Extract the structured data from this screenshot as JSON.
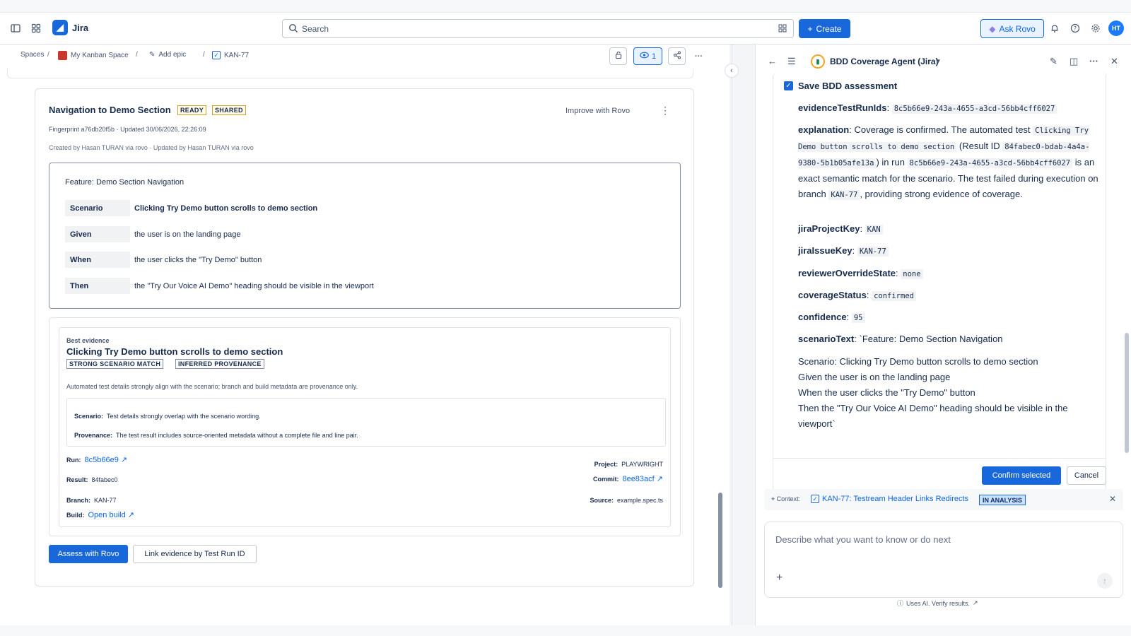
{
  "app": {
    "name": "Jira"
  },
  "search": {
    "placeholder": "Search"
  },
  "topbar": {
    "create_label": "Create",
    "ask_rovo_label": "Ask Rovo",
    "avatar_initials": "HT"
  },
  "breadcrumb": {
    "spaces": "Spaces",
    "space": "My Kanban Space",
    "epic": "Add epic",
    "issue": "KAN-77",
    "watch_count": "1"
  },
  "card": {
    "title": "Navigation to Demo Section",
    "tags": [
      "READY",
      "SHARED"
    ],
    "improve_label": "Improve with Rovo",
    "fingerprint": "Fingerprint a76db20f5b · Updated 30/06/2026, 22:26:09",
    "created_by": "Created by Hasan TURAN via rovo · Updated by Hasan TURAN via rovo",
    "feature": "Feature: Demo Section Navigation",
    "steps": [
      {
        "keyword": "Scenario",
        "text": "Clicking Try Demo button scrolls to demo section"
      },
      {
        "keyword": "Given",
        "text": "the user is on the landing page"
      },
      {
        "keyword": "When",
        "text": "the user clicks the \"Try Demo\" button"
      },
      {
        "keyword": "Then",
        "text": "the \"Try Our Voice AI Demo\" heading should be visible in the viewport"
      }
    ],
    "evidence": {
      "label": "Best evidence",
      "title": "Clicking Try Demo button scrolls to demo section",
      "tags": [
        "STRONG SCENARIO MATCH",
        "INFERRED PROVENANCE"
      ],
      "description": "Automated test details strongly align with the scenario; branch and build metadata are provenance only.",
      "scenario_label": "Scenario:",
      "scenario_text": "Test details strongly overlap with the scenario wording.",
      "provenance_label": "Provenance:",
      "provenance_text": "The test result includes source-oriented metadata without a complete file and line pair.",
      "run_label": "Run:",
      "run_value": "8c5b66e9 ↗",
      "result_label": "Result:",
      "result_value": "84fabec0",
      "branch_label": "Branch:",
      "branch_value": "KAN-77",
      "build_label": "Build:",
      "build_value": "Open build ↗",
      "project_label": "Project:",
      "project_value": "PLAYWRIGHT",
      "commit_label": "Commit:",
      "commit_value": "8ee83acf ↗",
      "source_label": "Source:",
      "source_value": "example.spec.ts"
    },
    "assess_label": "Assess with Rovo",
    "link_evidence_label": "Link evidence by Test Run ID"
  },
  "agent": {
    "name": "BDD Coverage Agent (Jira)",
    "save_title": "Save BDD assessment",
    "fields": {
      "evidenceTestRunIds_key": "evidenceTestRunIds",
      "evidenceTestRunIds_val": "8c5b66e9-243a-4655-a3cd-56bb4cff6027",
      "explanation_key": "explanation",
      "explanation_1": "Coverage is confirmed. The automated test ",
      "explanation_code1": "Clicking Try Demo button scrolls to demo section",
      "explanation_2": " (Result ID ",
      "explanation_code2": "84fabec0-bdab-4a4a-9380-5b1b05afe13a",
      "explanation_3": ") in run ",
      "explanation_code3": "8c5b66e9-243a-4655-a3cd-56bb4cff6027",
      "explanation_4": " is an exact semantic match for the scenario. The test failed during execution on branch ",
      "explanation_code4": "KAN-77",
      "explanation_5": ", providing strong evidence of coverage.",
      "jiraProjectKey_key": "jiraProjectKey",
      "jiraProjectKey_val": "KAN",
      "jiraIssueKey_key": "jiraIssueKey",
      "jiraIssueKey_val": "KAN-77",
      "reviewerOverrideState_key": "reviewerOverrideState",
      "reviewerOverrideState_val": "none",
      "coverageStatus_key": "coverageStatus",
      "coverageStatus_val": "confirmed",
      "confidence_key": "confidence",
      "confidence_val": "95",
      "scenarioText_key": "scenarioText",
      "scenarioText_val": "`Feature: Demo Section Navigation",
      "scenario_lines": [
        "Scenario: Clicking Try Demo button scrolls to demo section",
        "Given the user is on the landing page",
        "When the user clicks the \"Try Demo\" button",
        "Then the \"Try Our Voice AI Demo\" heading should be visible in the viewport`"
      ]
    },
    "confirm_label": "Confirm selected",
    "cancel_label": "Cancel",
    "context_label": "Context:",
    "context_link": "KAN-77: Testream Header Links Redirects",
    "context_status": "IN ANALYSIS",
    "compose_placeholder": "Describe what you want to know or do next",
    "ai_note": "Uses AI. Verify results."
  },
  "colors": {
    "brand": "#1868db",
    "tag_yellow": "#c9a227",
    "status_blue": "#cce0ff"
  }
}
